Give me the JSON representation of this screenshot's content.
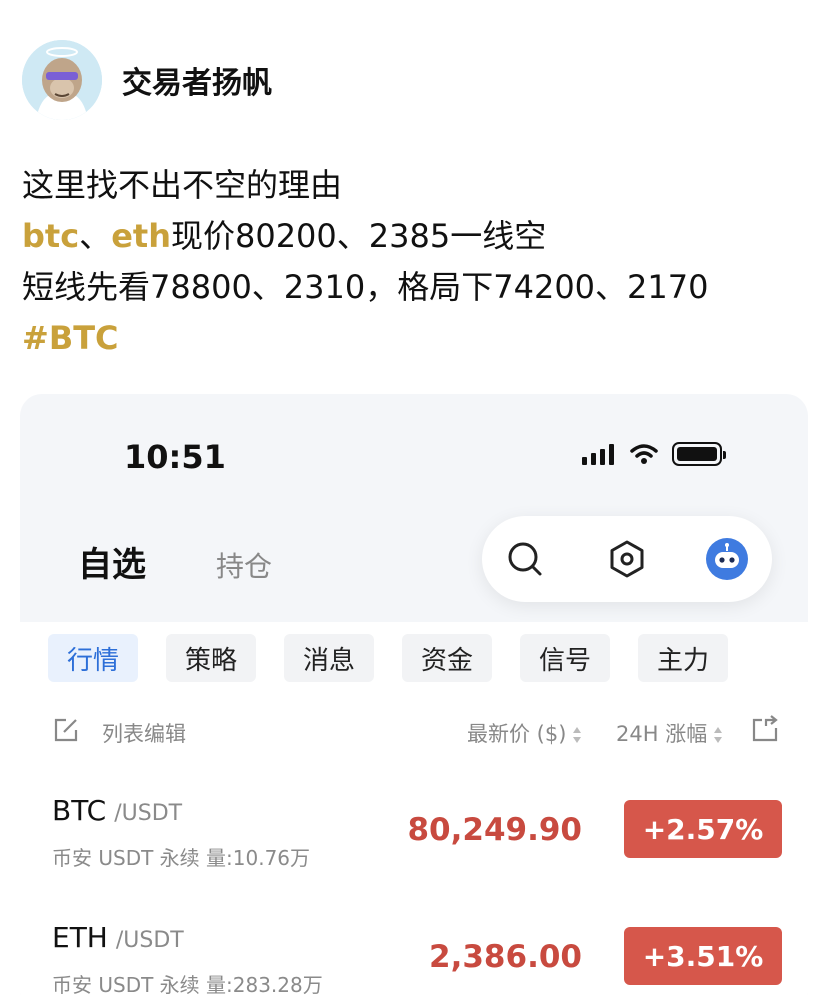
{
  "post": {
    "author": "交易者扬帆",
    "lines": {
      "line1": "这里找不出不空的理由",
      "line2_tag1": "btc",
      "line2_sep": "、",
      "line2_tag2": "eth",
      "line2_rest": "现价80200、2385一线空",
      "line3": "短线先看78800、2310，格局下74200、2170",
      "hashtag": "#BTC"
    },
    "accent_color": "#c9a13b"
  },
  "screenshot": {
    "status_time": "10:51",
    "tabs": {
      "main": "自选",
      "sub": "持仓"
    },
    "categories": [
      {
        "label": "行情",
        "active": true
      },
      {
        "label": "策略",
        "active": false
      },
      {
        "label": "消息",
        "active": false
      },
      {
        "label": "资金",
        "active": false
      },
      {
        "label": "信号",
        "active": false
      },
      {
        "label": "主力",
        "active": false
      }
    ],
    "list_header": {
      "edit_label": "列表编辑",
      "price_label": "最新价 ($)",
      "change_label": "24H 涨幅"
    },
    "rows": [
      {
        "symbol": "BTC",
        "pair": "/USDT",
        "sub": "币安 USDT 永续  量:10.76万",
        "price": "80,249.90",
        "change": "+2.57%"
      },
      {
        "symbol": "ETH",
        "pair": "/USDT",
        "sub": "币安 USDT 永续  量:283.28万",
        "price": "2,386.00",
        "change": "+3.51%"
      }
    ],
    "colors": {
      "up": "#d6574b",
      "price_up": "#c84a3f",
      "active_tab": "#2d6fd8"
    },
    "icons": [
      "search-icon",
      "hexagon-settings-icon",
      "robot-assistant-icon"
    ]
  }
}
